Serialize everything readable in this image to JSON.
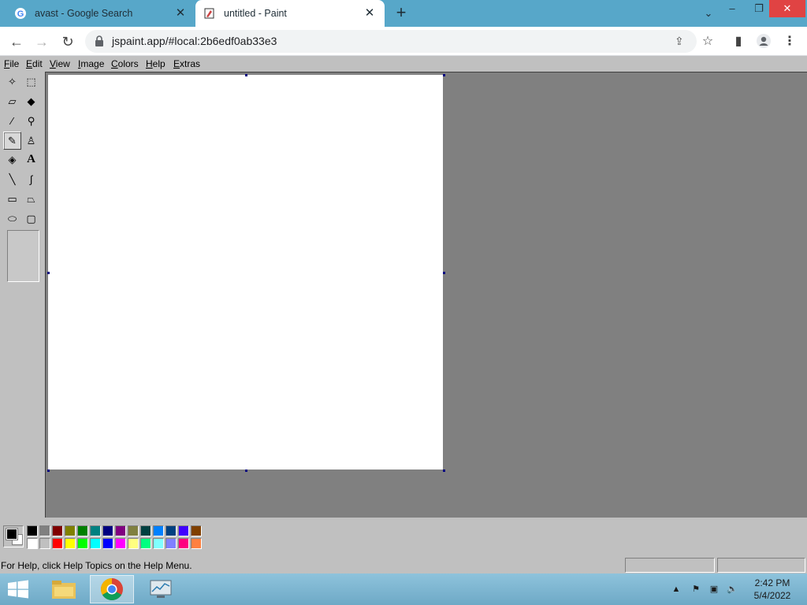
{
  "browser": {
    "tabs": [
      {
        "title": "avast - Google Search",
        "active": false,
        "icon": "google-g-icon"
      },
      {
        "title": "untitled - Paint",
        "active": true,
        "icon": "paint-icon"
      }
    ],
    "new_tab": "+",
    "url": "jspaint.app/#local:2b6edf0ab33e3"
  },
  "paint": {
    "menu": [
      "File",
      "Edit",
      "View",
      "Image",
      "Colors",
      "Help",
      "Extras"
    ],
    "tools": [
      {
        "name": "free-form-select",
        "icon": "✧"
      },
      {
        "name": "rect-select",
        "icon": "⬚"
      },
      {
        "name": "eraser",
        "icon": "▱"
      },
      {
        "name": "fill",
        "icon": "◆"
      },
      {
        "name": "pick-color",
        "icon": "⁄"
      },
      {
        "name": "magnifier",
        "icon": "⚲"
      },
      {
        "name": "pencil",
        "icon": "✎",
        "selected": true
      },
      {
        "name": "brush",
        "icon": "♙"
      },
      {
        "name": "airbrush",
        "icon": "◈"
      },
      {
        "name": "text",
        "icon": "A"
      },
      {
        "name": "line",
        "icon": "╲"
      },
      {
        "name": "curve",
        "icon": "∫"
      },
      {
        "name": "rectangle",
        "icon": "▭"
      },
      {
        "name": "polygon",
        "icon": "⏢"
      },
      {
        "name": "ellipse",
        "icon": "⬭"
      },
      {
        "name": "rounded-rectangle",
        "icon": "▢"
      }
    ],
    "foreground_color": "#000000",
    "background_color": "#ffffff",
    "palette_top": [
      "#000000",
      "#808080",
      "#800000",
      "#808000",
      "#008000",
      "#008080",
      "#000080",
      "#800080",
      "#808040",
      "#004040",
      "#0080ff",
      "#004080",
      "#4000ff",
      "#804000"
    ],
    "palette_bottom": [
      "#ffffff",
      "#c0c0c0",
      "#ff0000",
      "#ffff00",
      "#00ff00",
      "#00ffff",
      "#0000ff",
      "#ff00ff",
      "#ffff80",
      "#00ff80",
      "#80ffff",
      "#8080ff",
      "#ff0080",
      "#ff8040"
    ],
    "status": "For Help, click Help Topics on the Help Menu."
  },
  "taskbar": {
    "time": "2:42 PM",
    "date": "5/4/2022"
  }
}
